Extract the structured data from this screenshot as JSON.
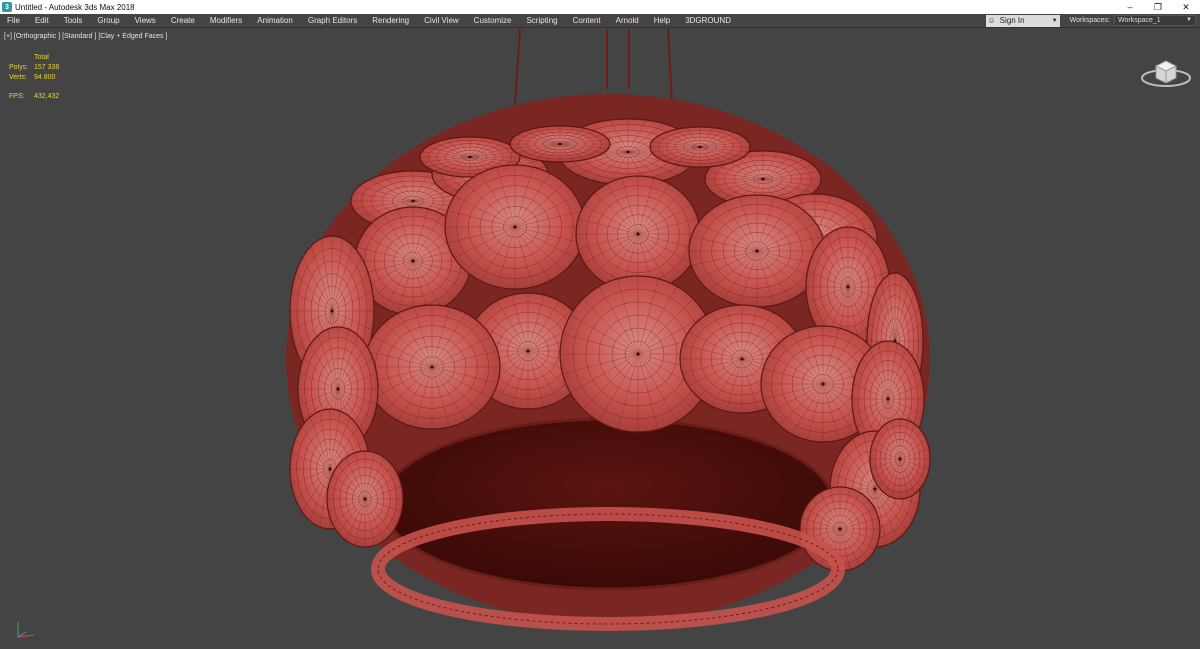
{
  "window": {
    "title": "Untitled - Autodesk 3ds Max 2018",
    "app_icon": "3ds-max-icon"
  },
  "menu": {
    "items": [
      "File",
      "Edit",
      "Tools",
      "Group",
      "Views",
      "Create",
      "Modifiers",
      "Animation",
      "Graph Editors",
      "Rendering",
      "Civil View",
      "Customize",
      "Scripting",
      "Content",
      "Arnold",
      "Help",
      "3DGROUND"
    ],
    "sign_in": "Sign In",
    "workspaces_label": "Workspaces:",
    "workspace_value": "Workspace_1"
  },
  "viewport": {
    "label": "[+] [Orthographic ] [Standard ] [Clay + Edged Faces ]",
    "stats": {
      "header": "Total",
      "polys_label": "Polys:",
      "polys_value": "157 338",
      "verts_label": "Verts:",
      "verts_value": "94 800",
      "fps_label": "FPS:",
      "fps_value": "432,432"
    },
    "model_color": "#c8504b",
    "background_color": "#444444"
  }
}
